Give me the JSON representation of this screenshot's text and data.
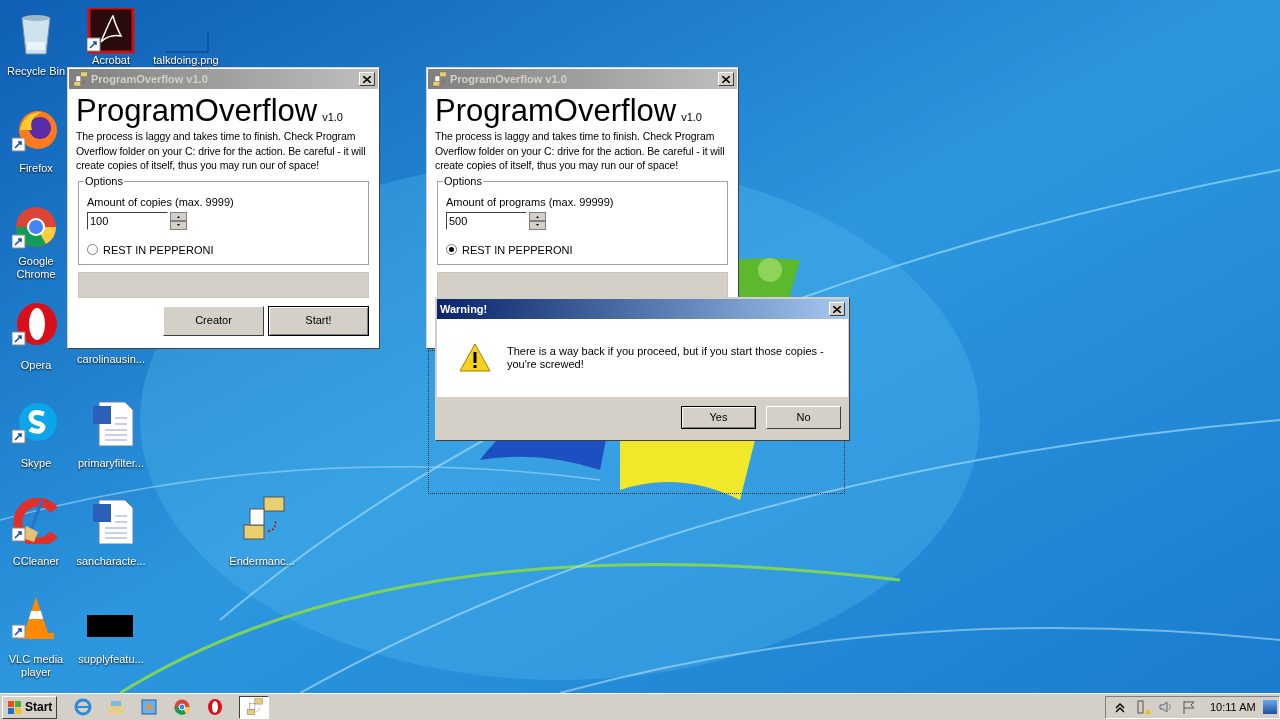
{
  "desktop_icons": [
    {
      "label": "Recycle Bin",
      "kind": "bin",
      "shortcut": false
    },
    {
      "label": "Acrobat",
      "kind": "pdf",
      "shortcut": true
    },
    {
      "label": "talkdoing.png",
      "kind": "blank",
      "shortcut": false
    },
    {
      "label": "Firefox",
      "kind": "firefox",
      "shortcut": true
    },
    {
      "label": "Google Chrome",
      "kind": "chrome",
      "shortcut": true
    },
    {
      "label": "Opera",
      "kind": "opera",
      "shortcut": true
    },
    {
      "label": "carolinausin...",
      "kind": "hidden"
    },
    {
      "label": "Skype",
      "kind": "skype",
      "shortcut": true
    },
    {
      "label": "primaryfilter...",
      "kind": "document",
      "shortcut": false
    },
    {
      "label": "CCleaner",
      "kind": "ccleaner",
      "shortcut": true
    },
    {
      "label": "sancharacte...",
      "kind": "document",
      "shortcut": false
    },
    {
      "label": "Endermanc...",
      "kind": "program",
      "shortcut": false
    },
    {
      "label": "VLC media player",
      "kind": "vlc",
      "shortcut": true
    },
    {
      "label": "supplyfeatu...",
      "kind": "black",
      "shortcut": false
    }
  ],
  "windows": [
    {
      "title": "ProgramOverflow v1.0",
      "active": false,
      "heading": "ProgramOverflow",
      "version": "v1.0",
      "description": "The process is laggy and takes time to finish. Check Program Overflow folder on your C: drive for the action. Be careful - it will create copies of itself, thus you may run our of space!",
      "options_label": "Options",
      "amount_label": "Amount of copies (max. 9999)",
      "amount_value": "100",
      "radio_label": "REST IN PEPPERONI",
      "radio_selected": false,
      "progress": {
        "level": 0
      },
      "buttons": [
        {
          "label": "Creator",
          "default": false
        },
        {
          "label": "Start!",
          "default": true
        }
      ]
    },
    {
      "title": "ProgramOverflow v1.0",
      "active": false,
      "heading": "ProgramOverflow",
      "version": "v1.0",
      "description": "The process is laggy and takes time to finish. Check Program Overflow folder on your C: drive for the action. Be careful - it will create copies of itself, thus you may run our of space!",
      "options_label": "Options",
      "amount_label": "Amount of programs (max. 99999)",
      "amount_value": "500",
      "radio_label": "REST IN PEPPERONI",
      "radio_selected": true,
      "progress": {
        "level": 0
      }
    }
  ],
  "dialog": {
    "title": "Warning!",
    "active": true,
    "message": "There is a way back if you proceed, but if you start those copies - you're screwed!",
    "buttons": [
      {
        "label": "Yes",
        "default": true
      },
      {
        "label": "No",
        "default": false
      }
    ]
  },
  "taskbar": {
    "start_label": "Start",
    "items": [
      {
        "kind": "ie",
        "active": false
      },
      {
        "kind": "explorer",
        "active": false
      },
      {
        "kind": "media",
        "active": false
      },
      {
        "kind": "chrome",
        "active": false
      },
      {
        "kind": "opera",
        "active": false
      },
      {
        "kind": "program",
        "active": true
      }
    ],
    "clock": "10:11 AM"
  }
}
